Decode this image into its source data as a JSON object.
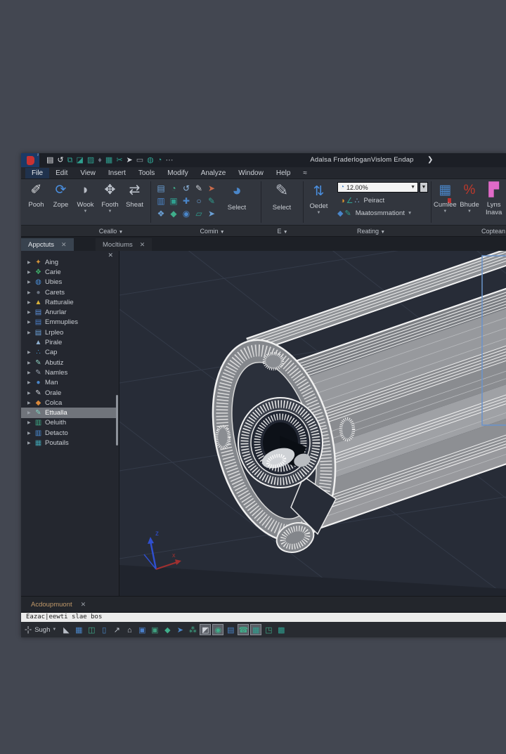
{
  "titlebar": {
    "title": "Adalsa FraderloganVislom Endap",
    "chevron": "❯",
    "logo_badge": "²",
    "quick_access": [
      {
        "name": "new-file-icon",
        "glyph": "▤",
        "color": "#e4e6e9"
      },
      {
        "name": "undo-icon",
        "glyph": "↺",
        "color": "#e4e6e9"
      },
      {
        "name": "copy-icon",
        "glyph": "⧉",
        "color": "#2f9f8f"
      },
      {
        "name": "save-icon",
        "glyph": "◪",
        "color": "#2f9f8f"
      },
      {
        "name": "export-icon",
        "glyph": "▨",
        "color": "#2f9f8f"
      },
      {
        "name": "pin-icon",
        "glyph": "♦",
        "color": "#6a7080"
      },
      {
        "name": "panel-icon",
        "glyph": "▦",
        "color": "#2f9f8f"
      },
      {
        "name": "tools-icon",
        "glyph": "✂",
        "color": "#2f9f8f"
      },
      {
        "name": "send-icon",
        "glyph": "➤",
        "color": "#d0d4da"
      },
      {
        "name": "keyboard-icon",
        "glyph": "▭",
        "color": "#9aa0a8"
      },
      {
        "name": "web-icon",
        "glyph": "◍",
        "color": "#2f9f8f"
      },
      {
        "name": "clock-icon",
        "glyph": "◔",
        "color": "#2f9f8f"
      },
      {
        "name": "more-icon",
        "glyph": "⋯",
        "color": "#9aa0a8"
      }
    ]
  },
  "menubar": {
    "items": [
      "File",
      "Edit",
      "View",
      "Insert",
      "Tools",
      "Modify",
      "Analyze",
      "Window",
      "Help",
      "≈"
    ],
    "active": "File"
  },
  "ribbon": {
    "group1": {
      "label": "Ceallo",
      "buttons": [
        {
          "label": "Pooh",
          "icon": "pen-icon",
          "glyph": "✐",
          "color": "#d8dadd",
          "caret": false
        },
        {
          "label": "Zope",
          "icon": "rotate-icon",
          "glyph": "⟳",
          "color": "#4a8fe0",
          "caret": false
        },
        {
          "label": "Wook",
          "icon": "wedge-icon",
          "glyph": "◗",
          "color": "#b8bdc6",
          "caret": true
        },
        {
          "label": "Footh",
          "icon": "move-icon",
          "glyph": "✥",
          "color": "#c0c6cf",
          "caret": true
        },
        {
          "label": "Sheat",
          "icon": "offset-icon",
          "glyph": "⇄",
          "color": "#c0c6cf",
          "caret": false
        }
      ]
    },
    "group2": {
      "label": "Comin",
      "grid_icons": [
        {
          "name": "array-icon",
          "glyph": "▤",
          "color": "#6a9fd4"
        },
        {
          "name": "pie-icon",
          "glyph": "◔",
          "color": "#3fae8a"
        },
        {
          "name": "undo-arc-icon",
          "glyph": "↺",
          "color": "#8fb8e0"
        },
        {
          "name": "pencil-icon",
          "glyph": "✎",
          "color": "#c8ccd2"
        },
        {
          "name": "flag-icon",
          "glyph": "➤",
          "color": "#c86a4a"
        },
        {
          "name": "rows-icon",
          "glyph": "▥",
          "color": "#4a86c9"
        },
        {
          "name": "stamp-icon",
          "glyph": "▣",
          "color": "#2f9f8f"
        },
        {
          "name": "plus-icon",
          "glyph": "✚",
          "color": "#4a86c9"
        },
        {
          "name": "circle-icon",
          "glyph": "○",
          "color": "#6a9fd4"
        },
        {
          "name": "nib-icon",
          "glyph": "✎",
          "color": "#2f9f8f"
        },
        {
          "name": "gem-icon",
          "glyph": "❖",
          "color": "#6a9fd4"
        },
        {
          "name": "diamond-icon",
          "glyph": "◆",
          "color": "#3fae8a"
        },
        {
          "name": "target-icon",
          "glyph": "◉",
          "color": "#4a86c9"
        },
        {
          "name": "plane-icon",
          "glyph": "▱",
          "color": "#2f9f8f"
        },
        {
          "name": "rocket-icon",
          "glyph": "➤",
          "color": "#6a9fd4"
        }
      ],
      "select_label": "Select",
      "select_icon": {
        "name": "pie-select-icon",
        "glyph": "◕",
        "color": "#4a86c9"
      }
    },
    "group3": {
      "label": "E",
      "select_label": "Select",
      "select_icon": {
        "name": "brush-select-icon",
        "glyph": "✎",
        "color": "#b8bdc6"
      }
    },
    "group4": {
      "label": "Reating",
      "oedet_label": "Oedet",
      "oedet_icon": {
        "name": "flip-icon",
        "glyph": "⇅",
        "color": "#4a8fe0"
      },
      "zoom_value": "12.00%",
      "combo_icon": {
        "name": "clock-icon",
        "glyph": "◔"
      },
      "row1_label": "Peiract",
      "row1_icons": [
        {
          "name": "half-moon-icon",
          "glyph": "◑",
          "color": "#d9932f"
        },
        {
          "name": "angle-icon",
          "glyph": "∠",
          "color": "#2f9f8f"
        },
        {
          "name": "dots-icon",
          "glyph": "∴",
          "color": "#7fa8d0"
        }
      ],
      "row2_label": "Maatosmmationt",
      "row2_icons": [
        {
          "name": "person-icon",
          "glyph": "◆",
          "color": "#4a86c9"
        },
        {
          "name": "flag2-icon",
          "glyph": "✎",
          "color": "#2f9f8f"
        }
      ]
    },
    "group5": {
      "label": "Coptean",
      "buttons": [
        {
          "label": "Cumlee",
          "icon": "calculator-icon",
          "glyph": "▦",
          "color": "#4a86c9",
          "caret": true
        },
        {
          "label": "Bhude",
          "icon": "percent-icon",
          "glyph": "%",
          "color": "#c0392b",
          "caret": true
        },
        {
          "label": "Lyns Inava",
          "icon": "layers-icon",
          "glyph": "▛",
          "color": "#e06ac8",
          "caret": false
        }
      ]
    }
  },
  "panel": {
    "tabs": [
      {
        "label": "Appctuts",
        "active": true
      },
      {
        "label": "Mocltiums",
        "active": false
      }
    ],
    "tree": [
      {
        "label": "Aing",
        "icon": "star-icon",
        "glyph": "✦",
        "color": "#d9973a",
        "arrow": true,
        "selected": false
      },
      {
        "label": "Carie",
        "icon": "clover-icon",
        "glyph": "❖",
        "color": "#3fae6a",
        "arrow": true,
        "selected": false
      },
      {
        "label": "Ubies",
        "icon": "globe-icon",
        "glyph": "◍",
        "color": "#4a8fd9",
        "arrow": true,
        "selected": false
      },
      {
        "label": "Carets",
        "icon": "sphere-icon",
        "glyph": "●",
        "color": "#6a7280",
        "arrow": true,
        "selected": false
      },
      {
        "label": "Ratturalie",
        "icon": "lamp-icon",
        "glyph": "▲",
        "color": "#d9b23a",
        "arrow": true,
        "selected": false
      },
      {
        "label": "Anurlar",
        "icon": "image-icon",
        "glyph": "▤",
        "color": "#5b8fd9",
        "arrow": true,
        "selected": false
      },
      {
        "label": "Emmuplies",
        "icon": "image-icon",
        "glyph": "▤",
        "color": "#4a7fc9",
        "arrow": true,
        "selected": false
      },
      {
        "label": "Lrpleo",
        "icon": "image-icon",
        "glyph": "▤",
        "color": "#6aa0d9",
        "arrow": true,
        "selected": false
      },
      {
        "label": "Pirale",
        "icon": "mountain-icon",
        "glyph": "▲",
        "color": "#8fb0d0",
        "arrow": false,
        "selected": false
      },
      {
        "label": "Cap",
        "icon": "dots-icon",
        "glyph": "∴",
        "color": "#4aa0d9",
        "arrow": true,
        "selected": false
      },
      {
        "label": "Abutiz",
        "icon": "leaf-pen-icon",
        "glyph": "✎",
        "color": "#8fd0c0",
        "arrow": true,
        "selected": false
      },
      {
        "label": "Namles",
        "icon": "sketch-icon",
        "glyph": "✎",
        "color": "#98a2ae",
        "arrow": true,
        "selected": false
      },
      {
        "label": "Man",
        "icon": "sphere-icon",
        "glyph": "●",
        "color": "#4a86c9",
        "arrow": true,
        "selected": false
      },
      {
        "label": "Orale",
        "icon": "pen-icon",
        "glyph": "✎",
        "color": "#d0d4da",
        "arrow": true,
        "selected": false
      },
      {
        "label": "Colca",
        "icon": "gem-icon",
        "glyph": "◆",
        "color": "#d9883a",
        "arrow": true,
        "selected": false
      },
      {
        "label": "Ettualla",
        "icon": "leaf-pen-icon",
        "glyph": "✎",
        "color": "#7fd0c0",
        "arrow": true,
        "selected": true
      },
      {
        "label": "Oeluith",
        "icon": "folder-icon",
        "glyph": "▥",
        "color": "#3fae8a",
        "arrow": true,
        "selected": false
      },
      {
        "label": "Detacto",
        "icon": "chart-icon",
        "glyph": "▥",
        "color": "#4a8fd9",
        "arrow": true,
        "selected": false
      },
      {
        "label": "Poutails",
        "icon": "image-icon",
        "glyph": "▦",
        "color": "#3f9fae",
        "arrow": true,
        "selected": false
      }
    ]
  },
  "viewport": {
    "ucs_z_label": "z",
    "ucs_x_label": "x",
    "selection_box_visible": true
  },
  "bottom": {
    "tab_label": "Acdoupmuont",
    "command_text": "Eazac|eewti   slae   bos",
    "status_label": "Sugh",
    "status_icons": [
      {
        "name": "snap-icon",
        "glyph": "◣",
        "color": "#b8bdc6",
        "active": false
      },
      {
        "name": "grid-icon",
        "glyph": "▦",
        "color": "#4a86c9",
        "active": false
      },
      {
        "name": "ortho-icon",
        "glyph": "◫",
        "color": "#3fae8a",
        "active": false
      },
      {
        "name": "polar-icon",
        "glyph": "▯",
        "color": "#4a86c9",
        "active": false
      },
      {
        "name": "arrow-icon",
        "glyph": "↗",
        "color": "#c0c6cf",
        "active": false
      },
      {
        "name": "home-icon",
        "glyph": "⌂",
        "color": "#c0c6cf",
        "active": false
      },
      {
        "name": "folder-icon",
        "glyph": "▣",
        "color": "#4a7fc9",
        "active": false
      },
      {
        "name": "box-icon",
        "glyph": "▣",
        "color": "#3f9f7f",
        "active": false
      },
      {
        "name": "gem-icon",
        "glyph": "◆",
        "color": "#3fae8a",
        "active": false
      },
      {
        "name": "send-icon",
        "glyph": "➤",
        "color": "#4a86c9",
        "active": false
      },
      {
        "name": "asterisk-icon",
        "glyph": "⁂",
        "color": "#3fae8a",
        "active": false
      },
      {
        "name": "pen-toggle-icon",
        "glyph": "◩",
        "color": "#d0d4da",
        "active": true
      },
      {
        "name": "orbit-toggle-icon",
        "glyph": "◉",
        "color": "#3fae8a",
        "active": true
      },
      {
        "name": "folder2-icon",
        "glyph": "▤",
        "color": "#4a86c9",
        "active": false
      },
      {
        "name": "phone-toggle-icon",
        "glyph": "☎",
        "color": "#3fae8a",
        "active": true
      },
      {
        "name": "tile-toggle-icon",
        "glyph": "▦",
        "color": "#2f9f8f",
        "active": true
      },
      {
        "name": "corner-icon",
        "glyph": "◳",
        "color": "#3fae8a",
        "active": false
      },
      {
        "name": "shade-icon",
        "glyph": "▩",
        "color": "#2f9f8f",
        "active": false
      }
    ]
  }
}
